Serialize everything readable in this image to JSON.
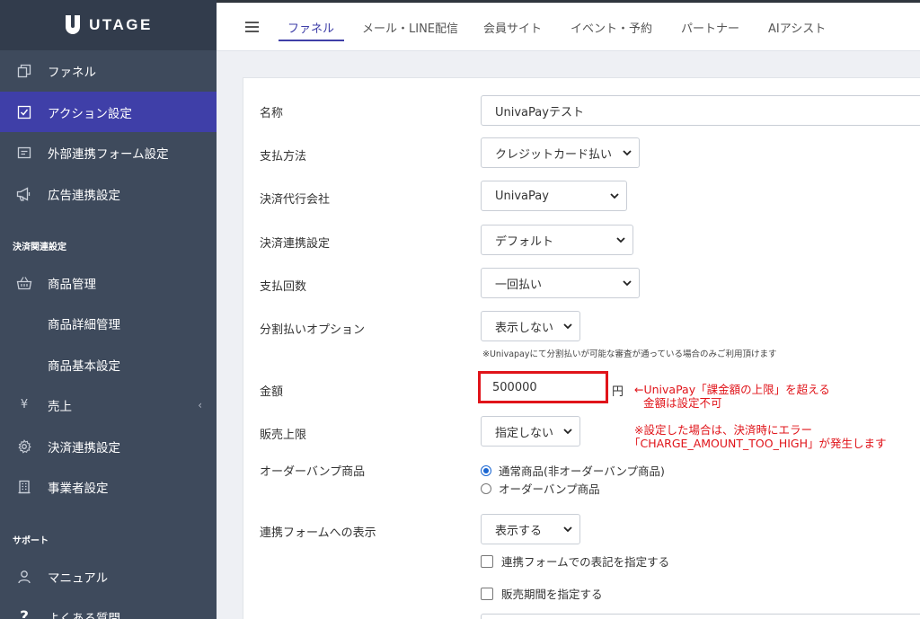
{
  "brand": {
    "name": "UTAGE"
  },
  "sidebar": {
    "items": [
      {
        "label": "ファネル",
        "icon": "copy-icon"
      },
      {
        "label": "アクション設定",
        "icon": "checkbox-icon",
        "active": true
      },
      {
        "label": "外部連携フォーム設定",
        "icon": "form-icon"
      },
      {
        "label": "広告連携設定",
        "icon": "megaphone-icon"
      }
    ],
    "section_payment": "決済関連設定",
    "payment_items": [
      {
        "label": "商品管理",
        "icon": "basket-icon"
      },
      {
        "label": "商品詳細管理"
      },
      {
        "label": "商品基本設定"
      },
      {
        "label": "売上",
        "icon": "yen-icon",
        "caret": "‹"
      },
      {
        "label": "決済連携設定",
        "icon": "gear-icon"
      },
      {
        "label": "事業者設定",
        "icon": "building-icon"
      }
    ],
    "section_support": "サポート",
    "support_items": [
      {
        "label": "マニュアル",
        "icon": "user-icon"
      },
      {
        "label": "よくある質問",
        "icon": "question-icon"
      }
    ]
  },
  "topnav": {
    "tabs": [
      "ファネル",
      "メール・LINE配信",
      "会員サイト",
      "イベント・予約",
      "パートナー",
      "AIアシスト"
    ]
  },
  "form": {
    "name_label": "名称",
    "name_value": "UnivaPayテスト",
    "payment_method_label": "支払方法",
    "payment_method_value": "クレジットカード払い",
    "agency_label": "決済代行会社",
    "agency_value": "UnivaPay",
    "integration_label": "決済連携設定",
    "integration_value": "デフォルト",
    "count_label": "支払回数",
    "count_value": "一回払い",
    "installment_label": "分割払いオプション",
    "installment_value": "表示しない",
    "installment_hint": "※Univapayにて分割払いが可能な審査が通っている場合のみご利用頂けます",
    "amount_label": "金額",
    "amount_value": "500000",
    "amount_unit": "円",
    "limit_label": "販売上限",
    "limit_value": "指定しない",
    "orderbump_label": "オーダーバンプ商品",
    "orderbump_options": [
      "通常商品(非オーダーバンプ商品)",
      "オーダーバンプ商品"
    ],
    "display_label": "連携フォームへの表示",
    "display_value": "表示する",
    "check_notation": "連携フォームでの表記を指定する",
    "check_period": "販売期間を指定する"
  },
  "annotation": {
    "line1": "←UnivaPay「課金額の上限」を超える",
    "line2": "金額は設定不可",
    "line3": "※設定した場合は、決済時にエラー",
    "line4": "「CHARGE_AMOUNT_TOO_HIGH」が発生します",
    "color": "#e0141a"
  },
  "colors": {
    "accent": "#3f3fa8",
    "sidebar": "#3e4a5c"
  }
}
